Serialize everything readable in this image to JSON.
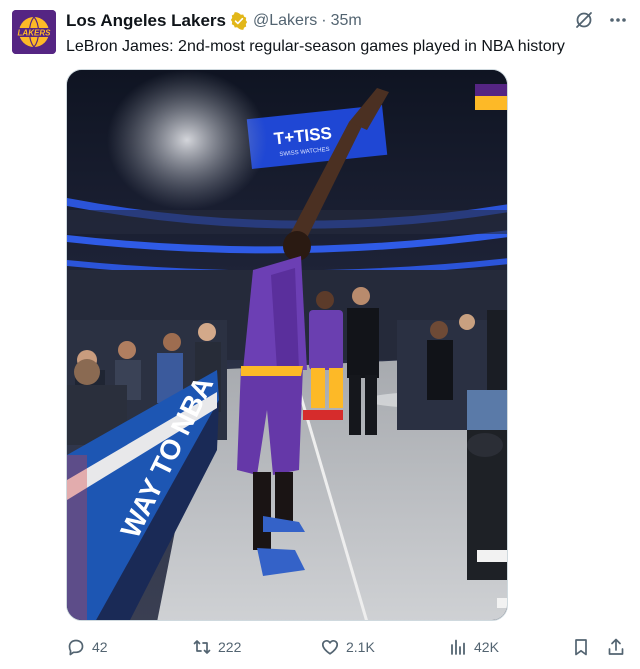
{
  "tweet": {
    "author_name": "Los Angeles Lakers",
    "handle": "@Lakers",
    "separator": "·",
    "time": "35m",
    "text": "LeBron James: 2nd-most regular-season games played in NBA history",
    "avatar_text": "LAKERS"
  },
  "media": {
    "scoreboard_text": "T+TISS",
    "scoreboard_sub": "SWISS WATCHES",
    "board_text": "WAY TO NBA"
  },
  "actions": {
    "replies": "42",
    "reposts": "222",
    "likes": "2.1K",
    "views": "42K"
  },
  "colors": {
    "brand_purple": "#552583",
    "brand_gold": "#fdb927",
    "verified_gold": "#e2b719",
    "muted": "#536471"
  },
  "icons": [
    "verified-icon",
    "grok-icon",
    "more-icon",
    "reply-icon",
    "repost-icon",
    "like-icon",
    "views-icon",
    "bookmark-icon",
    "share-icon"
  ]
}
